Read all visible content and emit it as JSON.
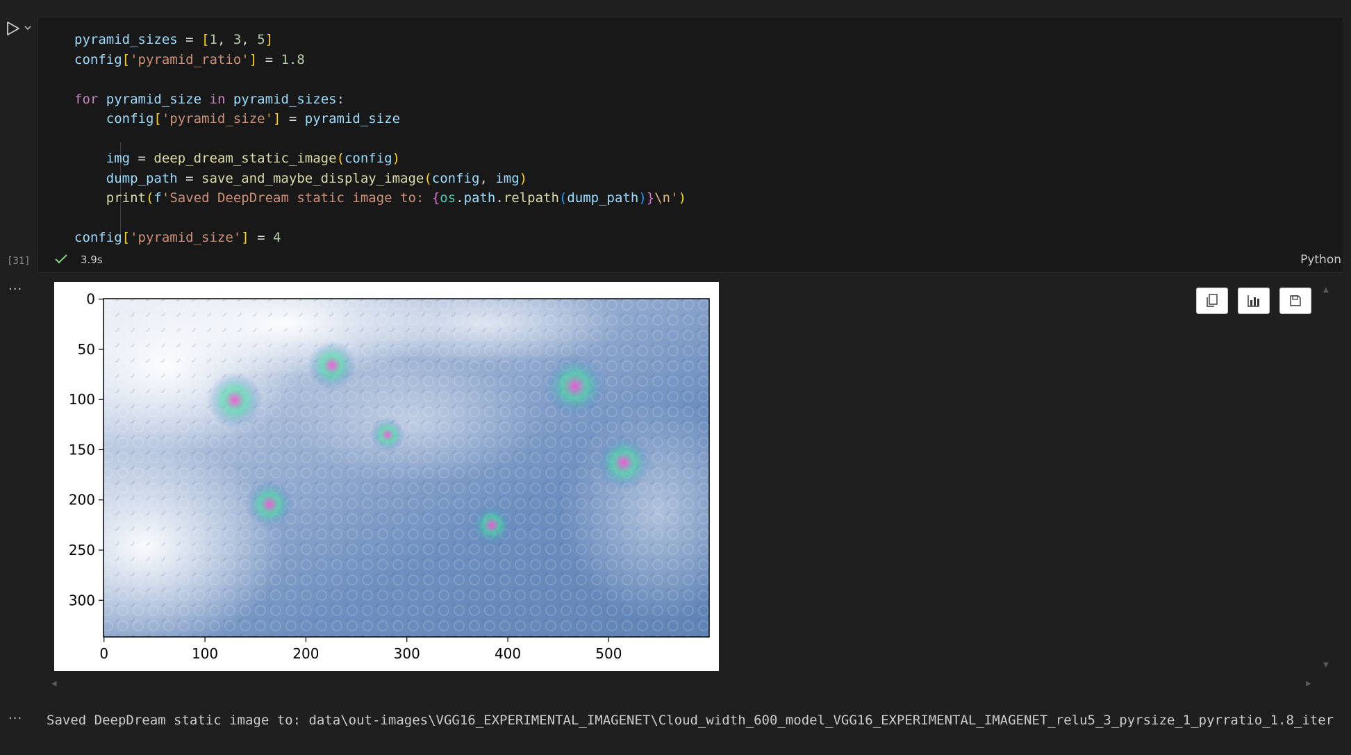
{
  "cell": {
    "execution_count": "[31]",
    "duration": "3.9s",
    "language": "Python",
    "code": {
      "l1": {
        "a": "pyramid_sizes",
        "b": " = ",
        "c": "[",
        "d": "1",
        "e": ", ",
        "f": "3",
        "g": ", ",
        "h": "5",
        "i": "]"
      },
      "l2": {
        "a": "config",
        "b": "[",
        "c": "'pyramid_ratio'",
        "d": "]",
        "e": " = ",
        "f": "1.8"
      },
      "l3": {
        "a": "for",
        "b": " ",
        "c": "pyramid_size",
        "d": " ",
        "e": "in",
        "f": " ",
        "g": "pyramid_sizes",
        "h": ":"
      },
      "l4": {
        "ind": "    ",
        "a": "config",
        "b": "[",
        "c": "'pyramid_size'",
        "d": "]",
        "e": " = ",
        "f": "pyramid_size"
      },
      "l5": {
        "ind": "    ",
        "a": "img",
        "b": " = ",
        "c": "deep_dream_static_image",
        "d": "(",
        "e": "config",
        "f": ")"
      },
      "l6": {
        "ind": "    ",
        "a": "dump_path",
        "b": " = ",
        "c": "save_and_maybe_display_image",
        "d": "(",
        "e": "config",
        "f": ", ",
        "g": "img",
        "h": ")"
      },
      "l7": {
        "ind": "    ",
        "a": "print",
        "b": "(",
        "c": "f",
        "d": "'Saved DeepDream static image to: ",
        "e": "{",
        "f": "os",
        "g": ".",
        "h": "path",
        "i": ".",
        "j": "relpath",
        "k": "(",
        "l": "dump_path",
        "m": ")",
        "n": "}",
        "o": "\\n",
        "p": "'",
        "q": ")"
      },
      "l8": {
        "a": "config",
        "b": "[",
        "c": "'pyramid_size'",
        "d": "]",
        "e": " = ",
        "f": "4"
      }
    }
  },
  "output": {
    "dots": "···",
    "plot": {
      "x_ticks": [
        "0",
        "100",
        "200",
        "300",
        "400",
        "500"
      ],
      "y_ticks": [
        "0",
        "50",
        "100",
        "150",
        "200",
        "250",
        "300"
      ],
      "image_description_icon": "deepdream-cloud-image"
    },
    "toolbar": [
      "copy-icon",
      "chart-icon",
      "save-icon"
    ],
    "stdout": "Saved DeepDream static image to: data\\out-images\\VGG16_EXPERIMENTAL_IMAGENET\\Cloud_width_600_model_VGG16_EXPERIMENTAL_IMAGENET_relu5_3_pyrsize_1_pyrratio_1.8_iter"
  }
}
